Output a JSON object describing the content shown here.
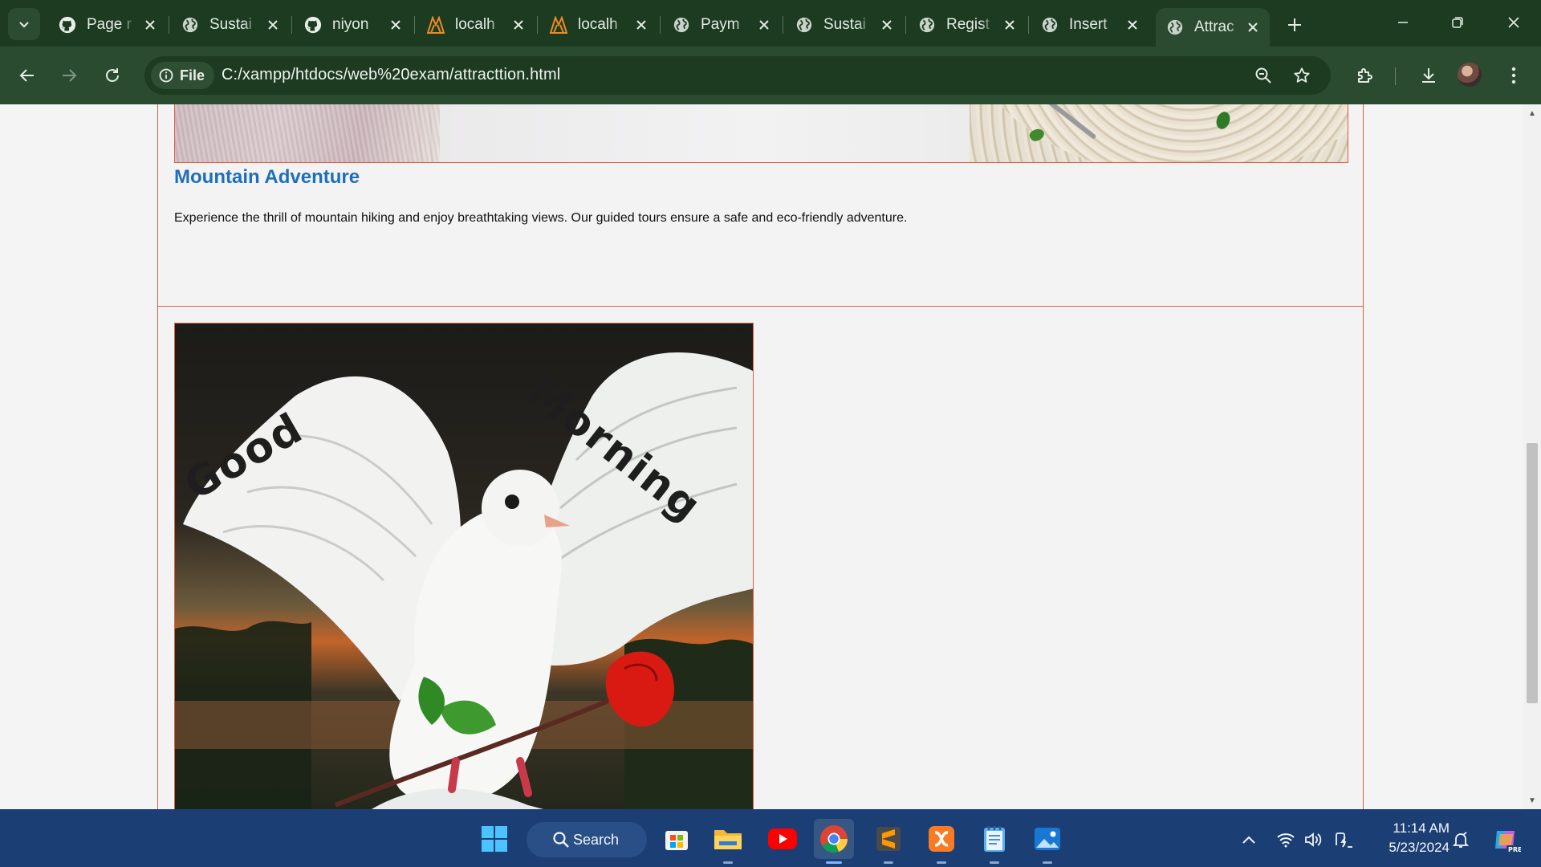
{
  "browser": {
    "tabs": [
      {
        "label": "Page r",
        "icon": "github-icon"
      },
      {
        "label": "Sustai",
        "icon": "globe-icon"
      },
      {
        "label": "niyon",
        "icon": "github-icon"
      },
      {
        "label": "localh",
        "icon": "xampp-icon"
      },
      {
        "label": "localh",
        "icon": "xampp-icon"
      },
      {
        "label": "Paym",
        "icon": "globe-icon"
      },
      {
        "label": "Sustai",
        "icon": "globe-icon"
      },
      {
        "label": "Regist",
        "icon": "globe-icon"
      },
      {
        "label": "Insert",
        "icon": "globe-icon"
      },
      {
        "label": "Attrac",
        "icon": "globe-icon",
        "active": true
      }
    ],
    "address": {
      "chip_label": "File",
      "url": "C:/xampp/htdocs/web%20exam/attracttion.html"
    },
    "colors": {
      "frame": "#1c3b21",
      "toolbar": "#2b4b30"
    }
  },
  "page": {
    "cards": [
      {
        "title": "Mountain Adventure",
        "description": "Experience the thrill of mountain hiking and enjoy breathtaking views. Our guided tours ensure a safe and eco-friendly adventure."
      },
      {
        "image_text": [
          "Good",
          "Morning"
        ]
      }
    ],
    "colors": {
      "title": "#1f6fb8",
      "border": "#d9603f"
    }
  },
  "taskbar": {
    "search_label": "Search",
    "apps": [
      "windows-start-icon",
      "microsoft-store-icon",
      "file-explorer-icon",
      "youtube-icon",
      "chrome-icon",
      "sublime-text-icon",
      "xampp-icon",
      "notepad-icon",
      "photos-icon"
    ],
    "clock": {
      "time": "11:14 AM",
      "date": "5/23/2024"
    }
  }
}
